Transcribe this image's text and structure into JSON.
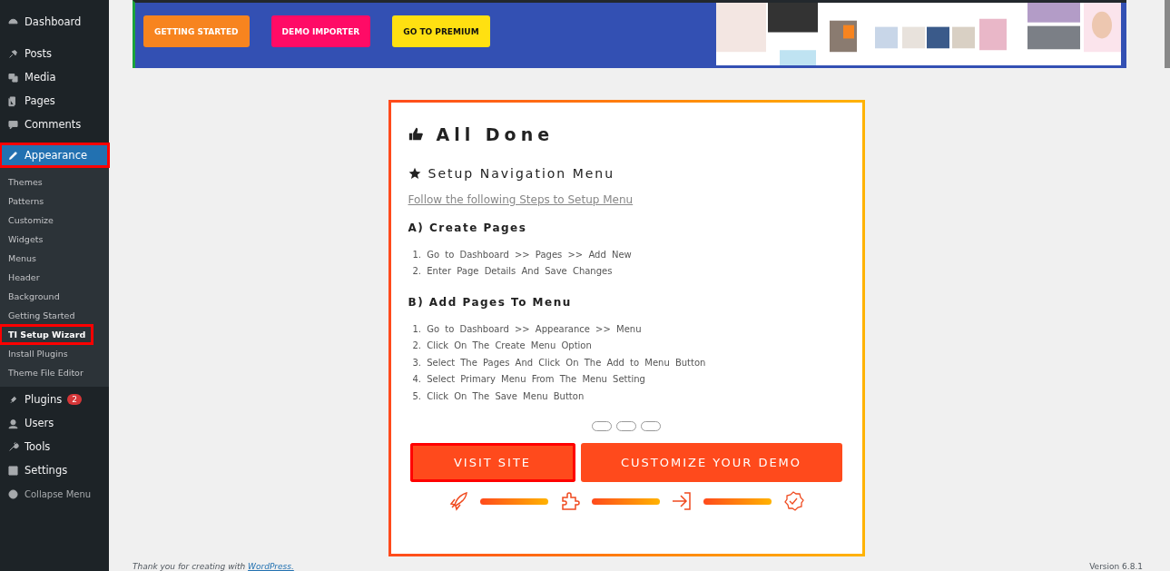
{
  "sidebar": {
    "items": [
      {
        "label": "Dashboard",
        "selected": false,
        "annotated": false
      },
      {
        "label": "Posts",
        "selected": false,
        "annotated": false
      },
      {
        "label": "Media",
        "selected": false,
        "annotated": false
      },
      {
        "label": "Pages",
        "selected": false,
        "annotated": false
      },
      {
        "label": "Comments",
        "selected": false,
        "annotated": false
      },
      {
        "label": "Appearance",
        "selected": true,
        "annotated": true,
        "children": [
          {
            "label": "Themes",
            "selected": false,
            "annotated": false
          },
          {
            "label": "Patterns",
            "selected": false,
            "annotated": false
          },
          {
            "label": "Customize",
            "selected": false,
            "annotated": false
          },
          {
            "label": "Widgets",
            "selected": false,
            "annotated": false
          },
          {
            "label": "Menus",
            "selected": false,
            "annotated": false
          },
          {
            "label": "Header",
            "selected": false,
            "annotated": false
          },
          {
            "label": "Background",
            "selected": false,
            "annotated": false
          },
          {
            "label": "Getting Started",
            "selected": false,
            "annotated": false
          },
          {
            "label": "TI Setup Wizard",
            "selected": true,
            "annotated": true
          },
          {
            "label": "Install Plugins",
            "selected": false,
            "annotated": false
          },
          {
            "label": "Theme File Editor",
            "selected": false,
            "annotated": false
          }
        ]
      },
      {
        "label": "Plugins",
        "selected": false,
        "annotated": false,
        "badge": "2"
      },
      {
        "label": "Users",
        "selected": false,
        "annotated": false
      },
      {
        "label": "Tools",
        "selected": false,
        "annotated": false
      },
      {
        "label": "Settings",
        "selected": false,
        "annotated": false
      },
      {
        "label": "Collapse Menu",
        "selected": false,
        "annotated": false,
        "kind": "collapse"
      }
    ]
  },
  "banner": {
    "buttons": [
      {
        "label": "GETTING STARTED",
        "color": "#f7841f"
      },
      {
        "label": "DEMO IMPORTER",
        "color": "#ff0b66"
      },
      {
        "label": "GO TO PREMIUM",
        "color": "#ffe011"
      }
    ]
  },
  "card": {
    "title": "All Done",
    "subtitle": "Setup Navigation Menu",
    "link": "Follow the following Steps to Setup Menu",
    "sections": [
      {
        "heading": "A) Create Pages",
        "steps": [
          {
            "number": "1.",
            "text": "Go to Dashboard >> Pages >> Add New"
          },
          {
            "number": "2.",
            "text": "Enter Page Details And Save Changes"
          }
        ]
      },
      {
        "heading": "B) Add Pages To Menu",
        "steps": [
          {
            "number": "1.",
            "text": "Go to Dashboard >> Appearance >> Menu"
          },
          {
            "number": "2.",
            "text": "Click On The Create Menu Option"
          },
          {
            "number": "3.",
            "text": "Select The Pages And Click On The Add to Menu Button"
          },
          {
            "number": "4.",
            "text": "Select Primary Menu From The Menu Setting"
          },
          {
            "number": "5.",
            "text": "Click On The Save Menu Button"
          }
        ]
      }
    ],
    "progress": [
      {
        "level": 1
      },
      {
        "level": 1
      },
      {
        "level": 1
      }
    ],
    "buttons": [
      {
        "label": "VISIT SITE",
        "annotated": true
      },
      {
        "label": "CUSTOMIZE YOUR DEMO",
        "annotated": false
      }
    ]
  },
  "footer": {
    "text": "Thank you for creating with",
    "link": "WordPress.",
    "version": "Version 6.8.1"
  }
}
